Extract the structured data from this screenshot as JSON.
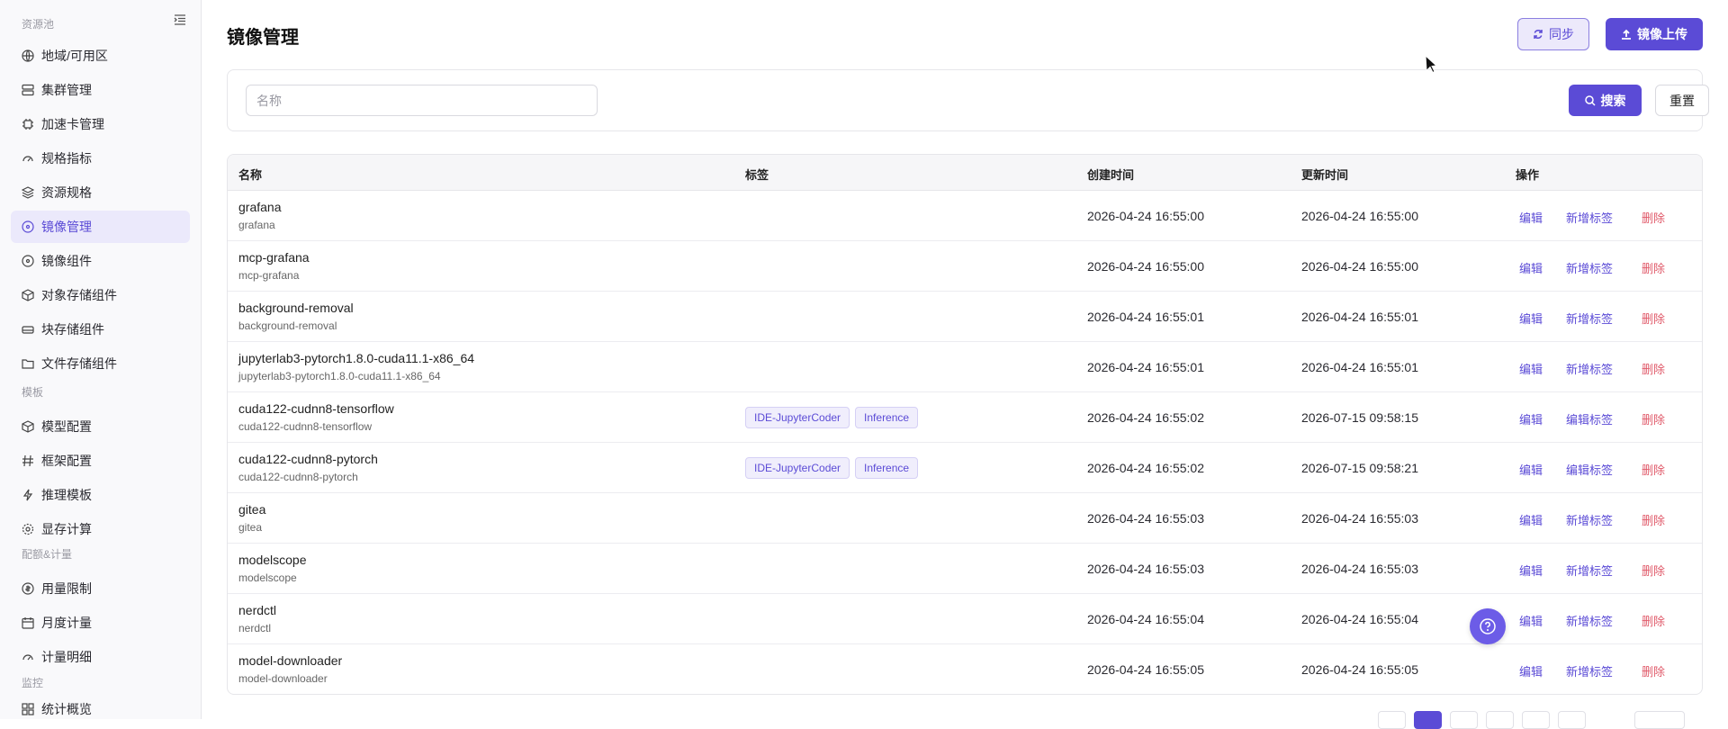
{
  "sidebar": {
    "sections": [
      {
        "title": "资源池"
      },
      {
        "title": "模板"
      },
      {
        "title": "配额&计量"
      },
      {
        "title": "监控"
      }
    ],
    "items": [
      {
        "label": "地域/可用区",
        "icon": "globe-icon"
      },
      {
        "label": "集群管理",
        "icon": "server-icon"
      },
      {
        "label": "加速卡管理",
        "icon": "chip-icon"
      },
      {
        "label": "规格指标",
        "icon": "gauge-icon"
      },
      {
        "label": "资源规格",
        "icon": "layers-icon"
      },
      {
        "label": "镜像管理",
        "icon": "disc-icon",
        "active": true
      },
      {
        "label": "镜像组件",
        "icon": "disc-icon"
      },
      {
        "label": "对象存储组件",
        "icon": "cube-icon"
      },
      {
        "label": "块存储组件",
        "icon": "drive-icon"
      },
      {
        "label": "文件存储组件",
        "icon": "folder-icon"
      },
      {
        "label": "模型配置",
        "icon": "cube-icon"
      },
      {
        "label": "框架配置",
        "icon": "hash-icon"
      },
      {
        "label": "推理模板",
        "icon": "bolt-icon"
      },
      {
        "label": "显存计算",
        "icon": "gear-icon"
      },
      {
        "label": "用量限制",
        "icon": "coin-icon"
      },
      {
        "label": "月度计量",
        "icon": "calendar-icon"
      },
      {
        "label": "计量明细",
        "icon": "gauge-icon"
      },
      {
        "label": "统计概览",
        "icon": "grid-icon"
      }
    ]
  },
  "header": {
    "title": "镜像管理",
    "sync_label": "同步",
    "upload_label": "镜像上传"
  },
  "filter": {
    "placeholder": "名称",
    "search_label": "搜索",
    "reset_label": "重置"
  },
  "table": {
    "columns": [
      "名称",
      "标签",
      "创建时间",
      "更新时间",
      "操作"
    ],
    "rows": [
      {
        "name": "grafana",
        "sub": "grafana",
        "tags": [],
        "created": "2026-04-24 16:55:00",
        "updated": "2026-04-24 16:55:00",
        "tag_action": "新增标签"
      },
      {
        "name": "mcp-grafana",
        "sub": "mcp-grafana",
        "tags": [],
        "created": "2026-04-24 16:55:00",
        "updated": "2026-04-24 16:55:00",
        "tag_action": "新增标签"
      },
      {
        "name": "background-removal",
        "sub": "background-removal",
        "tags": [],
        "created": "2026-04-24 16:55:01",
        "updated": "2026-04-24 16:55:01",
        "tag_action": "新增标签"
      },
      {
        "name": "jupyterlab3-pytorch1.8.0-cuda11.1-x86_64",
        "sub": "jupyterlab3-pytorch1.8.0-cuda11.1-x86_64",
        "tags": [],
        "created": "2026-04-24 16:55:01",
        "updated": "2026-04-24 16:55:01",
        "tag_action": "新增标签"
      },
      {
        "name": "cuda122-cudnn8-tensorflow",
        "sub": "cuda122-cudnn8-tensorflow",
        "tags": [
          "IDE-JupyterCoder",
          "Inference"
        ],
        "created": "2026-04-24 16:55:02",
        "updated": "2026-07-15 09:58:15",
        "tag_action": "编辑标签"
      },
      {
        "name": "cuda122-cudnn8-pytorch",
        "sub": "cuda122-cudnn8-pytorch",
        "tags": [
          "IDE-JupyterCoder",
          "Inference"
        ],
        "created": "2026-04-24 16:55:02",
        "updated": "2026-07-15 09:58:21",
        "tag_action": "编辑标签"
      },
      {
        "name": "gitea",
        "sub": "gitea",
        "tags": [],
        "created": "2026-04-24 16:55:03",
        "updated": "2026-04-24 16:55:03",
        "tag_action": "新增标签"
      },
      {
        "name": "modelscope",
        "sub": "modelscope",
        "tags": [],
        "created": "2026-04-24 16:55:03",
        "updated": "2026-04-24 16:55:03",
        "tag_action": "新增标签"
      },
      {
        "name": "nerdctl",
        "sub": "nerdctl",
        "tags": [],
        "created": "2026-04-24 16:55:04",
        "updated": "2026-04-24 16:55:04",
        "tag_action": "新增标签"
      },
      {
        "name": "model-downloader",
        "sub": "model-downloader",
        "tags": [],
        "created": "2026-04-24 16:55:05",
        "updated": "2026-04-24 16:55:05",
        "tag_action": "新增标签"
      }
    ],
    "edit_label": "编辑",
    "delete_label": "删除"
  },
  "colors": {
    "accent": "#5b4bd6",
    "danger": "#e05a6a"
  }
}
